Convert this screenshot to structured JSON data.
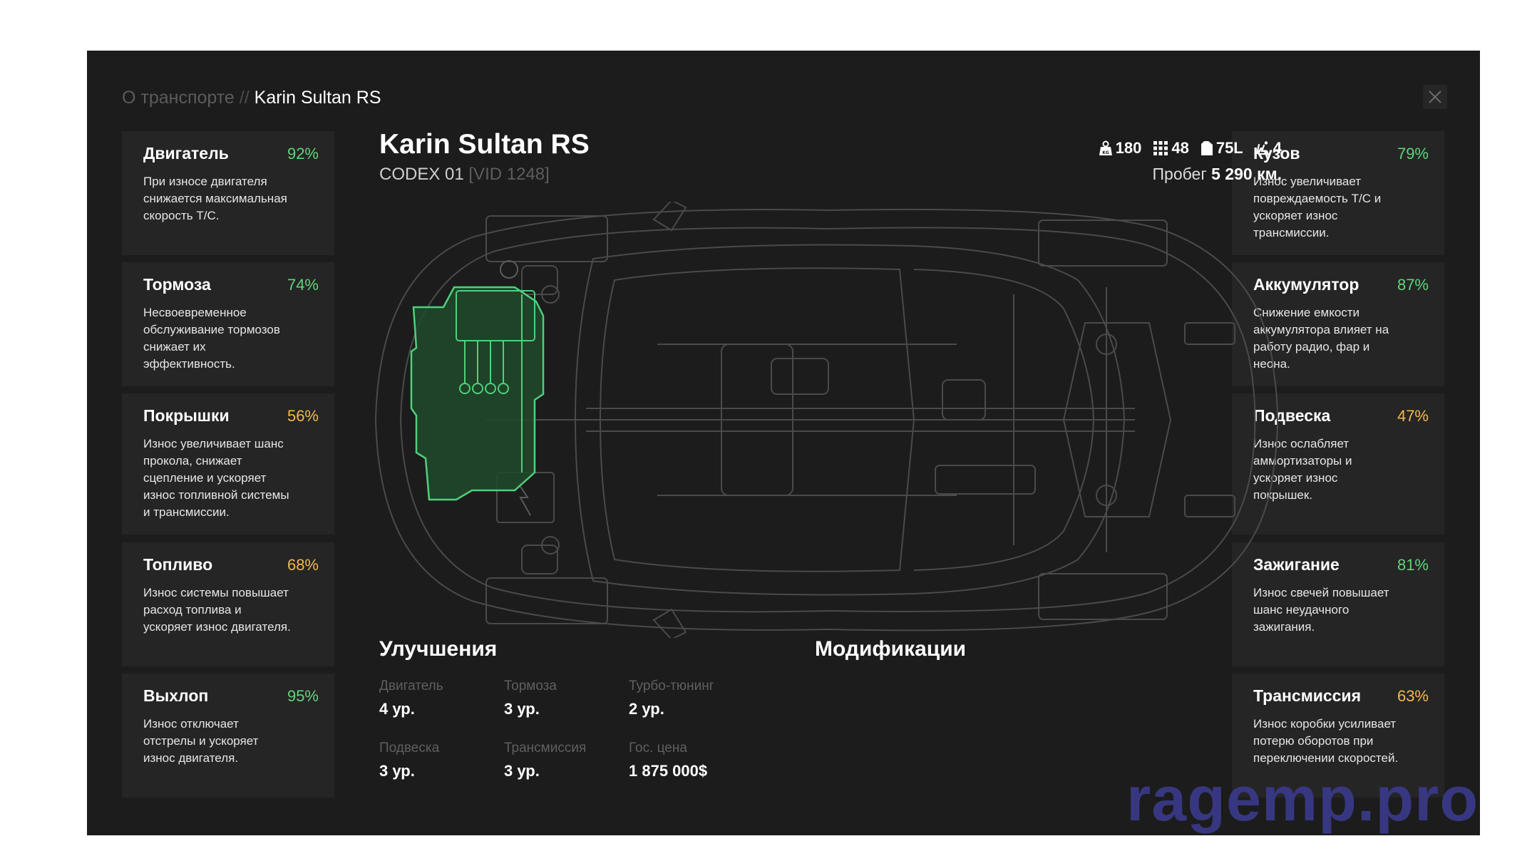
{
  "breadcrumb": {
    "parent": "О транспорте",
    "separator": "//",
    "current": "Karin Sultan RS"
  },
  "vehicle": {
    "name": "Karin Sultan RS",
    "plate": "CODEX 01",
    "vid": "[VID 1248]",
    "specs": [
      {
        "icon": "weight-icon",
        "value": "180"
      },
      {
        "icon": "grid-icon",
        "value": "48"
      },
      {
        "icon": "fuel-can-icon",
        "value": "75L"
      },
      {
        "icon": "seat-icon",
        "value": "4"
      }
    ],
    "mileage_label": "Пробег",
    "mileage_value": "5 290 км."
  },
  "left_cards": [
    {
      "title": "Двигатель",
      "percent": "92%",
      "color": "#5fd47b",
      "desc": [
        "При износе двигателя",
        "снижается максимальная",
        "скорость Т/С."
      ]
    },
    {
      "title": "Тормоза",
      "percent": "74%",
      "color": "#5fd47b",
      "desc": [
        "Несвоевременное",
        "обслуживание тормозов",
        "снижает их",
        "эффективность."
      ]
    },
    {
      "title": "Покрышки",
      "percent": "56%",
      "color": "#f2b84a",
      "desc": [
        "Износ увеличивает шанс",
        "прокола, снижает",
        "сцепление и ускоряет",
        "износ топливной системы",
        "и трансмиссии."
      ]
    },
    {
      "title": "Топливо",
      "percent": "68%",
      "color": "#f2b84a",
      "desc": [
        "Износ системы повышает",
        "расход топлива и",
        "ускоряет износ двигателя."
      ]
    },
    {
      "title": "Выхлоп",
      "percent": "95%",
      "color": "#5fd47b",
      "desc": [
        "Износ отключает",
        "отстрелы и ускоряет",
        "износ двигателя."
      ]
    }
  ],
  "right_cards": [
    {
      "title": "Кузов",
      "percent": "79%",
      "color": "#5fd47b",
      "desc": [
        "Износ увеличивает",
        "повреждаемость Т/С и",
        "ускоряет износ",
        "трансмиссии."
      ]
    },
    {
      "title": "Аккумулятор",
      "percent": "87%",
      "color": "#5fd47b",
      "desc": [
        "Снижение емкости",
        "аккумулятора влияет на",
        "работу радио, фар и",
        "неона."
      ]
    },
    {
      "title": "Подвеска",
      "percent": "47%",
      "color": "#f2b84a",
      "desc": [
        "Износ ослабляет",
        "аммортизаторы и",
        "ускоряет износ",
        "покрышек."
      ]
    },
    {
      "title": "Зажигание",
      "percent": "81%",
      "color": "#5fd47b",
      "desc": [
        "Износ свечей повышает",
        "шанс неудачного",
        "зажигания."
      ]
    },
    {
      "title": "Трансмиссия",
      "percent": "63%",
      "color": "#f2b84a",
      "desc": [
        "Износ коробки усиливает",
        "потерю оборотов при",
        "переключении скоростей."
      ]
    }
  ],
  "upgrades": {
    "title": "Улучшения",
    "items": [
      {
        "label": "Двигатель",
        "value": "4 ур."
      },
      {
        "label": "Тормоза",
        "value": "3 ур."
      },
      {
        "label": "Турбо-тюнинг",
        "value": "2 ур."
      },
      {
        "label": "Подвеска",
        "value": "3 ур."
      },
      {
        "label": "Трансмиссия",
        "value": "3 ур."
      },
      {
        "label": "Гос. цена",
        "value": "1 875 000$"
      }
    ]
  },
  "modifications": {
    "title": "Модификации"
  },
  "watermark": "ragemp.pro",
  "colors": {
    "green": "#5fd47b",
    "orange": "#f2b84a",
    "panel": "#1c1c1c",
    "card": "#252525",
    "engine_highlight": "#4fd07a"
  }
}
